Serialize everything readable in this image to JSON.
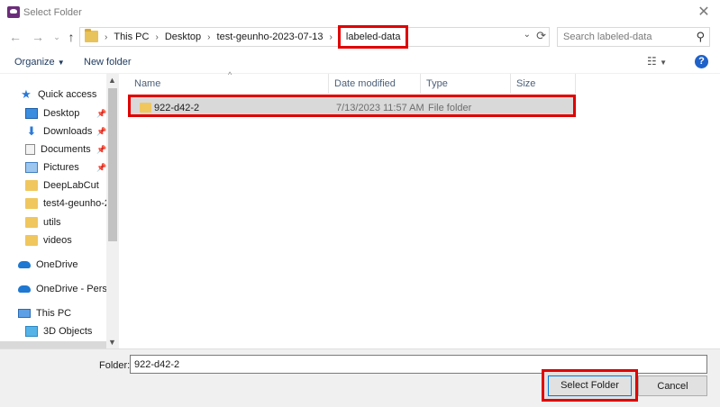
{
  "window": {
    "title": "Select Folder"
  },
  "address": {
    "crumbs": [
      "This PC",
      "Desktop",
      "test-geunho-2023-07-13"
    ],
    "current": "labeled-data"
  },
  "search": {
    "placeholder": "Search labeled-data"
  },
  "toolbar": {
    "organize": "Organize",
    "new_folder": "New folder"
  },
  "sidebar": {
    "items": [
      {
        "label": "Quick access"
      },
      {
        "label": "Desktop"
      },
      {
        "label": "Downloads"
      },
      {
        "label": "Documents"
      },
      {
        "label": "Pictures"
      },
      {
        "label": "DeepLabCut"
      },
      {
        "label": "test4-geunho-20"
      },
      {
        "label": "utils"
      },
      {
        "label": "videos"
      },
      {
        "label": "OneDrive"
      },
      {
        "label": "OneDrive - Person"
      },
      {
        "label": "This PC"
      },
      {
        "label": "3D Objects"
      }
    ]
  },
  "columns": {
    "name": "Name",
    "date": "Date modified",
    "type": "Type",
    "size": "Size"
  },
  "files": [
    {
      "name": "922-d42-2",
      "date": "7/13/2023 11:57 AM",
      "type": "File folder",
      "size": ""
    }
  ],
  "footer": {
    "folder_label": "Folder:",
    "folder_value": "922-d42-2",
    "select_button": "Select Folder",
    "cancel_button": "Cancel"
  },
  "colors": {
    "highlight": "#e00000",
    "selection": "#d9d9d9",
    "accent": "#0078d7"
  }
}
